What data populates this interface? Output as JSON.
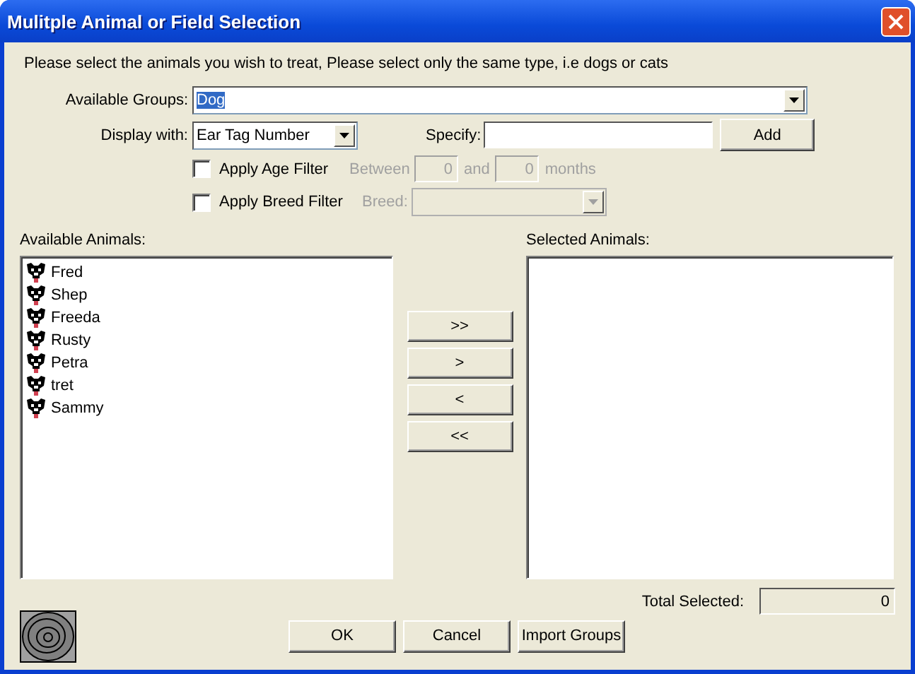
{
  "window": {
    "title": "Mulitple Animal or Field Selection"
  },
  "instruction": "Please select the animals you wish to treat, Please select only the same type, i.e dogs or cats",
  "available_groups": {
    "label": "Available Groups:",
    "value": "Dog",
    "text_selected": true
  },
  "display_with": {
    "label": "Display with:",
    "value": "Ear Tag Number"
  },
  "specify": {
    "label": "Specify:",
    "button": "Add"
  },
  "age_filter": {
    "label": "Apply Age Filter",
    "checked": false,
    "between_label": "Between",
    "from": "0",
    "and_label": "and",
    "to": "0",
    "unit_label": "months",
    "disabled": true
  },
  "breed_filter": {
    "label": "Apply Breed Filter",
    "checked": false,
    "breed_label": "Breed:",
    "disabled": true
  },
  "available_animals": {
    "label": "Available Animals:",
    "items": [
      {
        "name": "Fred"
      },
      {
        "name": "Shep"
      },
      {
        "name": "Freeda"
      },
      {
        "name": "Rusty"
      },
      {
        "name": "Petra"
      },
      {
        "name": "tret"
      },
      {
        "name": "Sammy"
      }
    ]
  },
  "selected_animals": {
    "label": "Selected Animals:"
  },
  "transfer_buttons": [
    ">>",
    ">",
    "<",
    "<<"
  ],
  "total_selected": {
    "label": "Total Selected:",
    "value": "0"
  },
  "buttons": [
    "OK",
    "Cancel",
    "Import Groups"
  ]
}
